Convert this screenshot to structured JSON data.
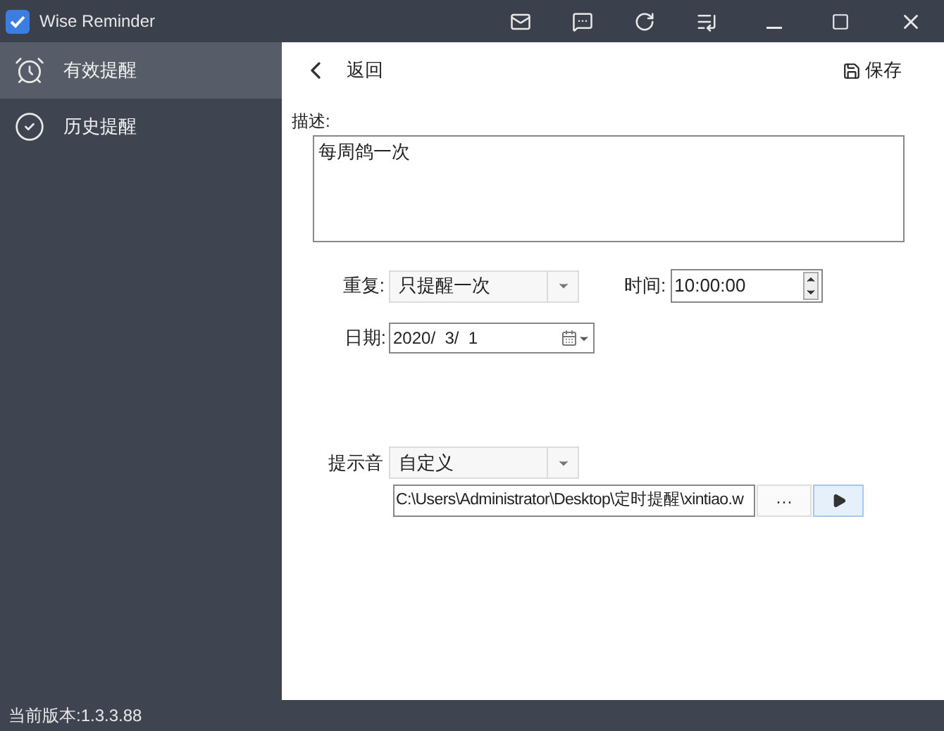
{
  "window": {
    "title": "Wise Reminder"
  },
  "sidebar": {
    "items": [
      {
        "label": "有效提醒",
        "selected": true,
        "kind": "clock"
      },
      {
        "label": "历史提醒",
        "selected": false,
        "kind": "check"
      }
    ]
  },
  "toolbar": {
    "back": "返回",
    "save": "保存"
  },
  "form": {
    "description_label": "描述:",
    "description": "每周鸽一次",
    "repeat": {
      "label": "重复:",
      "value": "只提醒一次"
    },
    "time": {
      "label": "时间:",
      "value": "10:00:00"
    },
    "date": {
      "label": "日期:",
      "value": "2020/  3/  1"
    },
    "sound": {
      "label": "提示音",
      "value": "自定义",
      "path": "C:\\Users\\Administrator\\Desktop\\定时提醒\\xintiao.w",
      "browse": "···"
    }
  },
  "status_bar": "当前版本:1.3.3.88"
}
